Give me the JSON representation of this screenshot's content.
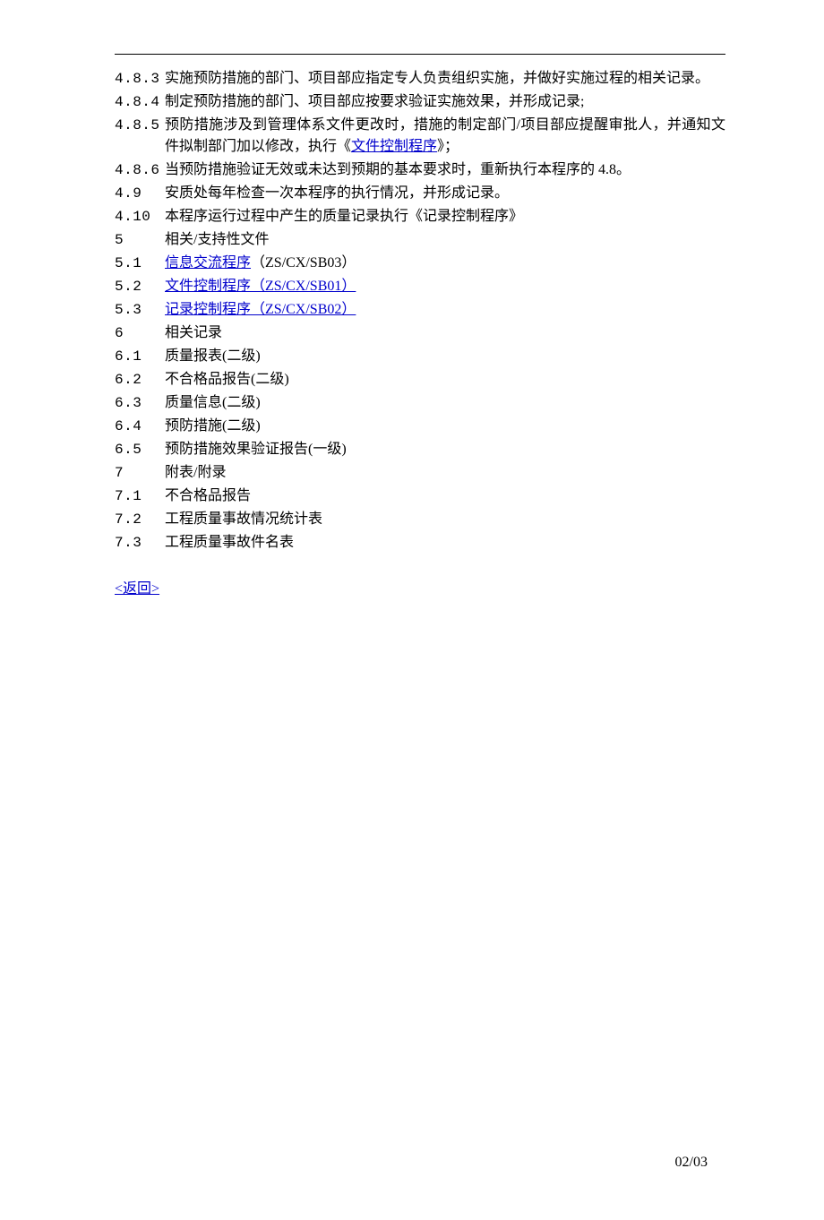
{
  "items": [
    {
      "num": "4.8.3",
      "pre": "实施预防措施的部门、项目部应指定专人负责组织实施，并做好实施过程的相关记录。"
    },
    {
      "num": "4.8.4",
      "pre": "制定预防措施的部门、项目部应按要求验证实施效果，并形成记录;"
    },
    {
      "num": "4.8.5",
      "pre": "预防措施涉及到管理体系文件更改时，措施的制定部门/项目部应提醒审批人，并通知文件拟制部门加以修改，执行《",
      "link": "文件控制程序",
      "post": "》；"
    },
    {
      "num": "4.8.6",
      "pre": "当预防措施验证无效或未达到预期的基本要求时，重新执行本程序的 4.8。"
    },
    {
      "num": "4.9",
      "pre": "安质处每年检查一次本程序的执行情况，并形成记录。"
    },
    {
      "num": "4.10",
      "pre": "本程序运行过程中产生的质量记录执行《记录控制程序》"
    },
    {
      "num": "5",
      "pre": "相关/支持性文件"
    },
    {
      "num": "5.1",
      "link": "信息交流程序",
      "post_roman": "（ZS/CX/SB03）"
    },
    {
      "num": "5.2",
      "link": "文件控制程序（ZS/CX/SB01）"
    },
    {
      "num": "5.3",
      "link": "记录控制程序（ZS/CX/SB02）"
    },
    {
      "num": "6",
      "pre": "相关记录"
    },
    {
      "num": "6.1",
      "pre": "质量报表(二级)"
    },
    {
      "num": "6.2",
      "pre": "不合格品报告(二级)"
    },
    {
      "num": "6.3",
      "pre": "质量信息(二级)"
    },
    {
      "num": "6.4",
      "pre": "预防措施(二级)"
    },
    {
      "num": "6.5",
      "pre": "预防措施效果验证报告(一级)"
    },
    {
      "num": "7",
      "pre": "附表/附录"
    },
    {
      "num": "7.1",
      "pre": "不合格品报告"
    },
    {
      "num": "7.2",
      "pre": "工程质量事故情况统计表"
    },
    {
      "num": "7.3",
      "pre": "工程质量事故件名表"
    }
  ],
  "back": "<返回>",
  "page_number": "02/03"
}
